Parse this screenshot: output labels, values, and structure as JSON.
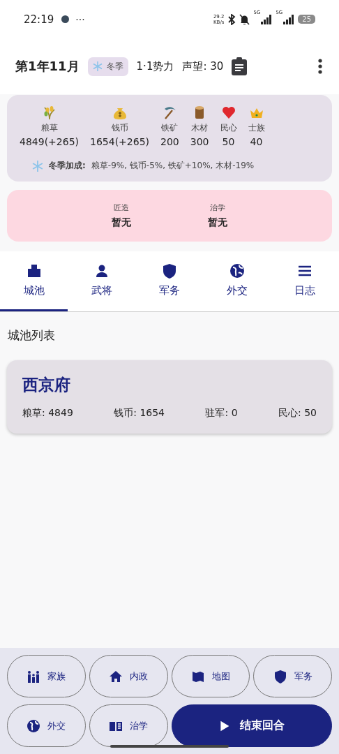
{
  "status_bar": {
    "time": "22:19",
    "more": "···",
    "speed": "29.2",
    "speed_unit": "KB/s",
    "network_1": "5G",
    "network_2": "5G",
    "battery": "25"
  },
  "header": {
    "date": "第1年11月",
    "season": "冬季",
    "faction": "1·1势力",
    "prestige": "声望: 30"
  },
  "resources": [
    {
      "label": "粮草",
      "value": "4849(+265)"
    },
    {
      "label": "钱币",
      "value": "1654(+265)"
    },
    {
      "label": "铁矿",
      "value": "200"
    },
    {
      "label": "木材",
      "value": "300"
    },
    {
      "label": "民心",
      "value": "50"
    },
    {
      "label": "士族",
      "value": "40"
    }
  ],
  "season_bonus": {
    "label": "冬季加成:",
    "text": "粮草-9%, 钱币-5%, 铁矿+10%, 木材-19%"
  },
  "projects": [
    {
      "label": "匠造",
      "value": "暂无"
    },
    {
      "label": "治学",
      "value": "暂无"
    }
  ],
  "tabs": [
    {
      "label": "城池",
      "selected": true
    },
    {
      "label": "武将",
      "selected": false
    },
    {
      "label": "军务",
      "selected": false
    },
    {
      "label": "外交",
      "selected": false
    },
    {
      "label": "日志",
      "selected": false
    }
  ],
  "section_title": "城池列表",
  "cities": [
    {
      "name": "西京府",
      "stats": [
        "粮草: 4849",
        "钱币: 1654",
        "驻军: 0",
        "民心: 50"
      ]
    }
  ],
  "actions": [
    {
      "label": "家族",
      "kind": "outline"
    },
    {
      "label": "内政",
      "kind": "outline"
    },
    {
      "label": "地图",
      "kind": "outline"
    },
    {
      "label": "军务",
      "kind": "outline"
    },
    {
      "label": "外交",
      "kind": "outline"
    },
    {
      "label": "治学",
      "kind": "outline"
    },
    {
      "label": "结束回合",
      "kind": "primary"
    }
  ]
}
